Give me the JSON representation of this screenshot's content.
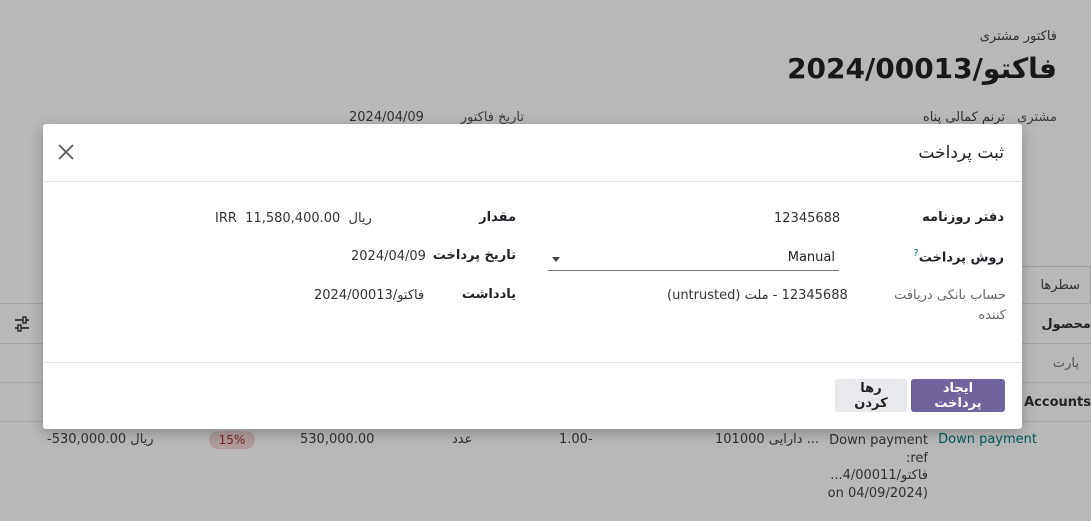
{
  "background": {
    "subtitle": "فاکتور مشتری",
    "title": "فاکتو/2024/00013",
    "customer_label": "مشتری",
    "customer_value": "ترنم کمالی پناه",
    "invoice_date_label": "تاریخ فاکتور",
    "invoice_date_value": "2024/04/09",
    "tab_label": "سطرها",
    "column_header_right": "محصول",
    "column_header_accounts": "Accounts",
    "partner_cell": "پارت",
    "row": {
      "label": "Down payment",
      "description_lines": [
        "Down payment",
        "ref:",
        "فاکتو/4/00011...",
        "(on 04/09/2024"
      ],
      "account": "101000 دارایی ...",
      "quantity": "1.00-",
      "uom": "عدد",
      "price": "530,000.00",
      "tax": "15%",
      "subtotal": "-530,000.00 ریال"
    }
  },
  "dialog": {
    "title": "ثبت پرداخت",
    "journal_label": "دفتر روزنامه",
    "journal_value": "12345688",
    "payment_method_label": "روش پرداخت",
    "payment_method_help": "?",
    "payment_method_value": "Manual",
    "recipient_bank_label": "حساب بانکی دریافت کننده",
    "recipient_bank_value": "12345688 - ملت (untrusted)",
    "amount_label": "مقدار",
    "amount_value": "11,580,400.00",
    "amount_currency_symbol": "ریال",
    "amount_currency_code": "IRR",
    "payment_date_label": "تاریخ پرداخت",
    "payment_date_value": "2024/04/09",
    "memo_label": "یادداشت",
    "memo_value": "فاکتو/2024/00013",
    "create_button": "ایجاد پرداخت",
    "discard_button": "رها کردن"
  },
  "icons": {
    "close": "close-icon",
    "settings": "sliders-icon",
    "dropdown": "caret-down-icon"
  },
  "colors": {
    "primary": "#71639e",
    "secondary": "#e7e9ed",
    "link": "#017e84",
    "badge_bg": "#f3d9d9"
  }
}
